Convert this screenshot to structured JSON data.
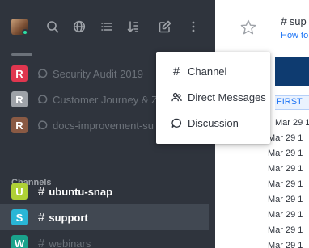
{
  "sidebar": {
    "bg_color": "#2f343d",
    "topbar_icons": [
      {
        "name": "search-icon"
      },
      {
        "name": "directory-icon"
      },
      {
        "name": "display-icon"
      },
      {
        "name": "sort-icon"
      },
      {
        "name": "create-new-icon"
      },
      {
        "name": "kebab-menu-icon"
      }
    ],
    "discussions": [
      {
        "initial": "R",
        "label": "Security Audit 2019",
        "avatar_color": "#e0364f"
      },
      {
        "initial": "R",
        "label": "Customer Journey & Z",
        "avatar_color": "#9ea2a8"
      },
      {
        "initial": "R",
        "label": "docs-improvement-su",
        "avatar_color": "#8a5a44"
      }
    ],
    "channels_title": "Channels",
    "channels": [
      {
        "initial": "U",
        "label": "ubuntu-snap",
        "avatar_color": "#afd136",
        "active": false
      },
      {
        "initial": "S",
        "label": "support",
        "avatar_color": "#29b6d6",
        "active": true
      },
      {
        "initial": "W",
        "label": "webinars",
        "avatar_color": "#1aa38c",
        "active": false
      }
    ]
  },
  "dropdown": {
    "items": [
      {
        "icon": "hash-icon",
        "label": "Channel"
      },
      {
        "icon": "direct-messages-icon",
        "label": "Direct Messages"
      },
      {
        "icon": "discussion-icon",
        "label": "Discussion"
      }
    ]
  },
  "main": {
    "room_title": "sup",
    "room_topic": "How to",
    "first_label": "FIRST",
    "dates": [
      "Mar 29 1",
      "Mar 29 1",
      "Mar 29 1",
      "Mar 29 1",
      "Mar 29 1",
      "Mar 29 1",
      "Mar 29 1",
      "Mar 29 1",
      "Mar 29 1"
    ],
    "accent_color": "#1d74f5"
  }
}
